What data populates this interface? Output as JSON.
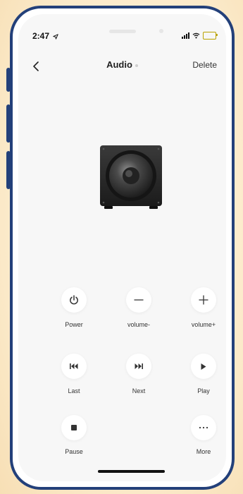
{
  "status": {
    "time": "2:47"
  },
  "header": {
    "title": "Audio",
    "delete_label": "Delete"
  },
  "device": {
    "image": "subwoofer-speaker"
  },
  "controls": {
    "power": {
      "label": "Power",
      "icon": "power-icon"
    },
    "volume_down": {
      "label": "volume-",
      "icon": "minus-icon"
    },
    "volume_up": {
      "label": "volume+",
      "icon": "plus-icon"
    },
    "last": {
      "label": "Last",
      "icon": "previous-icon"
    },
    "next": {
      "label": "Next",
      "icon": "next-icon"
    },
    "play": {
      "label": "Play",
      "icon": "play-icon"
    },
    "pause": {
      "label": "Pause",
      "icon": "stop-icon"
    },
    "more": {
      "label": "More",
      "icon": "more-icon"
    }
  },
  "colors": {
    "accent_frame": "#23407a",
    "background": "#fcefd2",
    "icon": "#333333",
    "battery": "#ffd60a"
  }
}
